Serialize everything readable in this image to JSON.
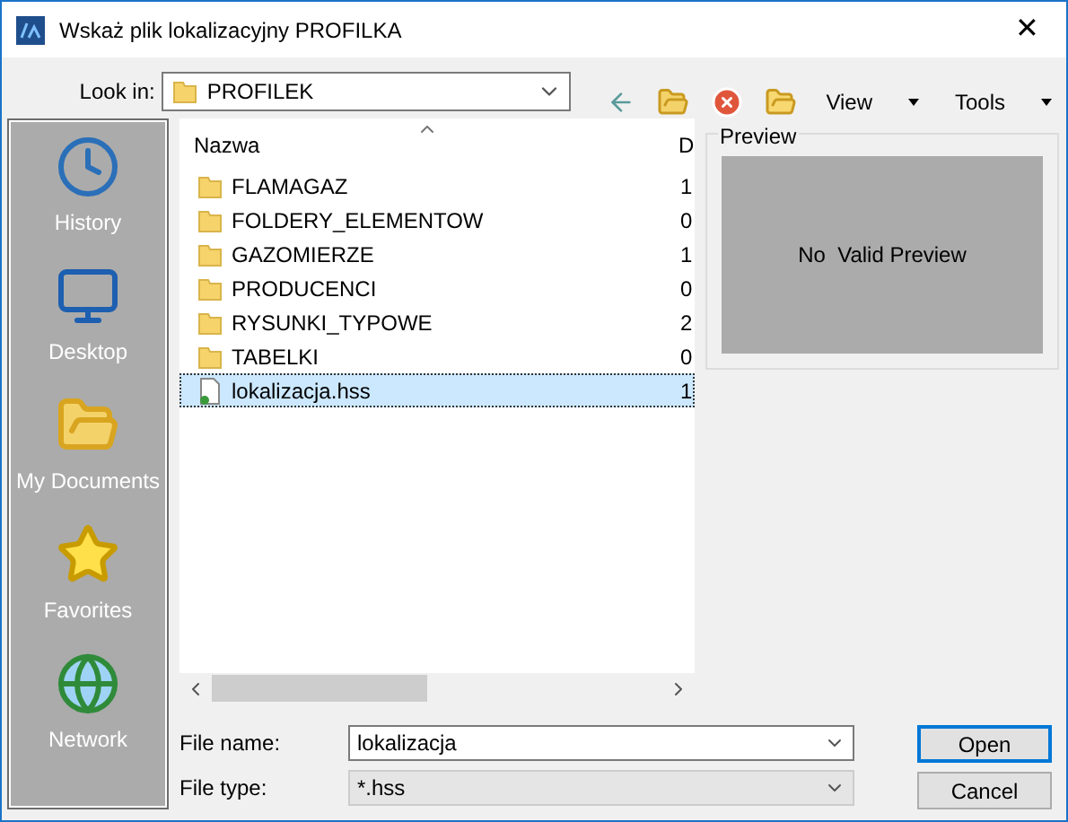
{
  "window": {
    "title": "Wskaż plik lokalizacyjny PROFILKA",
    "close": "✕"
  },
  "look_in": {
    "label": "Look in:",
    "value": "PROFILEK"
  },
  "toolbar": [
    {
      "kind": "back"
    },
    {
      "kind": "up"
    },
    {
      "kind": "delete"
    },
    {
      "kind": "newfolder"
    },
    {
      "kind": "menu",
      "label": "View"
    },
    {
      "kind": "menu",
      "label": "Tools"
    }
  ],
  "places": [
    {
      "label": "History",
      "kind": "history"
    },
    {
      "label": "Desktop",
      "kind": "desktop"
    },
    {
      "label": "My Documents",
      "kind": "documents"
    },
    {
      "label": "Favorites",
      "kind": "favorites"
    },
    {
      "label": "Network",
      "kind": "network"
    }
  ],
  "file_list": {
    "columns": [
      "Nazwa",
      "D"
    ],
    "rows": [
      {
        "kind": "folder",
        "name": "FLAMAGAZ",
        "column_2": "1",
        "selected": false
      },
      {
        "kind": "folder",
        "name": "FOLDERY_ELEMENTOW",
        "column_2": "0",
        "selected": false
      },
      {
        "kind": "folder",
        "name": "GAZOMIERZE",
        "column_2": "1",
        "selected": false
      },
      {
        "kind": "folder",
        "name": "PRODUCENCI",
        "column_2": "0",
        "selected": false
      },
      {
        "kind": "folder",
        "name": "RYSUNKI_TYPOWE",
        "column_2": "2",
        "selected": false
      },
      {
        "kind": "folder",
        "name": "TABELKI",
        "column_2": "0",
        "selected": false
      },
      {
        "kind": "file",
        "name": "lokalizacja.hss",
        "column_2": "1",
        "selected": true
      }
    ]
  },
  "preview": {
    "title": "Preview",
    "message": "No  Valid Preview"
  },
  "file_name": {
    "label": "File name:",
    "value": "lokalizacja"
  },
  "file_type": {
    "label": "File type:",
    "value": "*.hss"
  },
  "buttons": [
    {
      "label": "Open",
      "default": true
    },
    {
      "label": "Cancel",
      "default": false
    }
  ]
}
